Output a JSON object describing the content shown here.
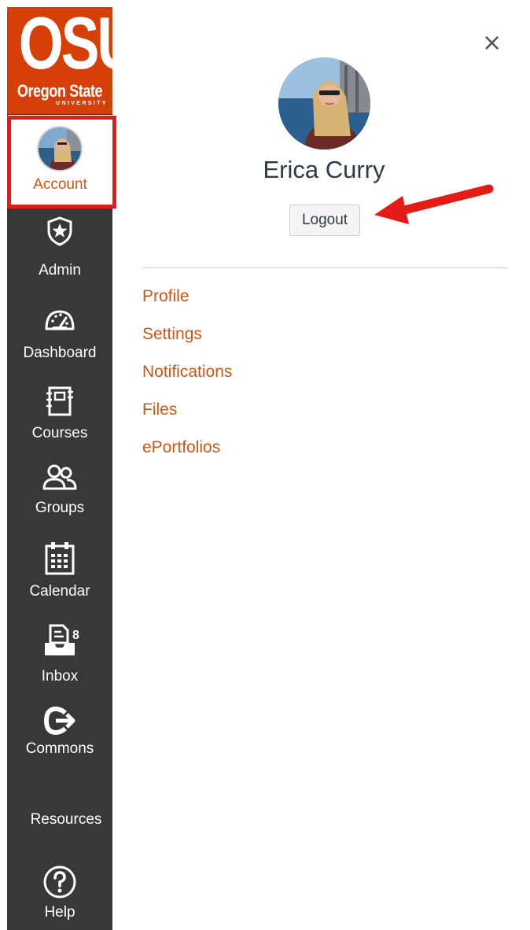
{
  "logo": {
    "main": "OSU",
    "sub": "Oregon State",
    "univ": "UNIVERSITY"
  },
  "account": {
    "label": "Account"
  },
  "nav": [
    {
      "id": "admin",
      "label": "Admin",
      "icon": "shield-star-icon"
    },
    {
      "id": "dashboard",
      "label": "Dashboard",
      "icon": "speedometer-icon"
    },
    {
      "id": "courses",
      "label": "Courses",
      "icon": "notebook-icon"
    },
    {
      "id": "groups",
      "label": "Groups",
      "icon": "people-icon"
    },
    {
      "id": "calendar",
      "label": "Calendar",
      "icon": "calendar-icon"
    },
    {
      "id": "inbox",
      "label": "Inbox",
      "icon": "inbox-icon",
      "badge": "8"
    },
    {
      "id": "commons",
      "label": "Commons",
      "icon": "commons-arrow-icon"
    },
    {
      "id": "resources",
      "label": "Resources"
    },
    {
      "id": "help",
      "label": "Help",
      "icon": "question-circle-icon"
    }
  ],
  "panel": {
    "close": "×",
    "user_name": "Erica Curry",
    "logout_label": "Logout",
    "links": [
      "Profile",
      "Settings",
      "Notifications",
      "Files",
      "ePortfolios"
    ]
  },
  "colors": {
    "sidebar_bg": "#383838",
    "brand_orange": "#d73f09",
    "link": "#c9571a",
    "highlight_red": "#e41b17"
  }
}
